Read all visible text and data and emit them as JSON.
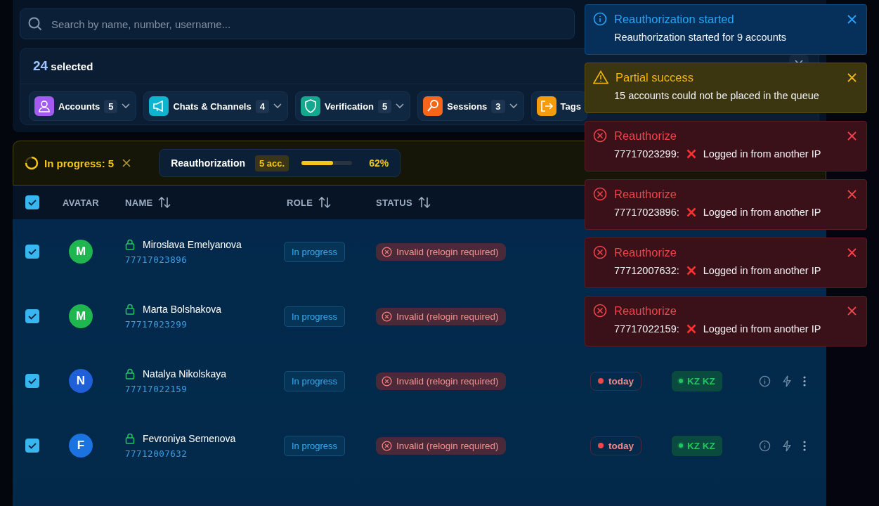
{
  "search": {
    "placeholder": "Search by name, number, username..."
  },
  "selection": {
    "count": "24",
    "label": "selected",
    "categories": [
      {
        "label": "Accounts",
        "count": "5",
        "color": "#a35cf0"
      },
      {
        "label": "Chats & Channels",
        "count": "4",
        "color": "#0fb5cf"
      },
      {
        "label": "Verification",
        "count": "5",
        "color": "#14a88e"
      },
      {
        "label": "Sessions",
        "count": "3",
        "color": "#f5661a"
      },
      {
        "label": "Tags",
        "color": "#f59a0b"
      }
    ]
  },
  "progress": {
    "label": "In progress: 5",
    "job": {
      "name": "Reauthorization",
      "count": "5 acc.",
      "level": 0.62,
      "percent": "62%"
    }
  },
  "table": {
    "header_checked": true,
    "columns": [
      {
        "label": "AVATAR",
        "sortable": false
      },
      {
        "label": "NAME",
        "sortable": true
      },
      {
        "label": "ROLE",
        "sortable": true
      },
      {
        "label": "STATUS",
        "sortable": true
      }
    ],
    "rows": [
      {
        "checked": true,
        "initial": "M",
        "color": "#1fb64f",
        "name": "Miroslava Emelyanova",
        "phone": "77717023896",
        "role": "In progress",
        "status": "Invalid (relogin required)"
      },
      {
        "checked": true,
        "initial": "M",
        "color": "#1fb64f",
        "name": "Marta Bolshakova",
        "phone": "77717023299",
        "role": "In progress",
        "status": "Invalid (relogin required)"
      },
      {
        "checked": true,
        "initial": "N",
        "color": "#1f5fd8",
        "name": "Natalya Nikolskaya",
        "phone": "77717022159",
        "role": "In progress",
        "status": "Invalid (relogin required)",
        "last_seen": "today",
        "geo": "KZ KZ"
      },
      {
        "checked": true,
        "initial": "F",
        "color": "#1a73e0",
        "name": "Fevroniya Semenova",
        "phone": "77712007632",
        "role": "In progress",
        "status": "Invalid (relogin required)",
        "last_seen": "today",
        "geo": "KZ KZ"
      }
    ]
  },
  "toasts": [
    {
      "kind": "info",
      "title": "Reauthorization started",
      "message": "Reauthorization started for 9 accounts"
    },
    {
      "kind": "warning",
      "title": "Partial success",
      "message": "15 accounts could not be placed in the queue"
    },
    {
      "kind": "error",
      "title": "Reauthorize",
      "number": "77717023299:",
      "message": "Logged in from another IP"
    },
    {
      "kind": "error",
      "title": "Reauthorize",
      "number": "77717023896:",
      "message": "Logged in from another IP"
    },
    {
      "kind": "error",
      "title": "Reauthorize",
      "number": "77712007632:",
      "message": "Logged in from another IP"
    },
    {
      "kind": "error",
      "title": "Reauthorize",
      "number": "77717022159:",
      "message": "Logged in from another IP"
    }
  ]
}
